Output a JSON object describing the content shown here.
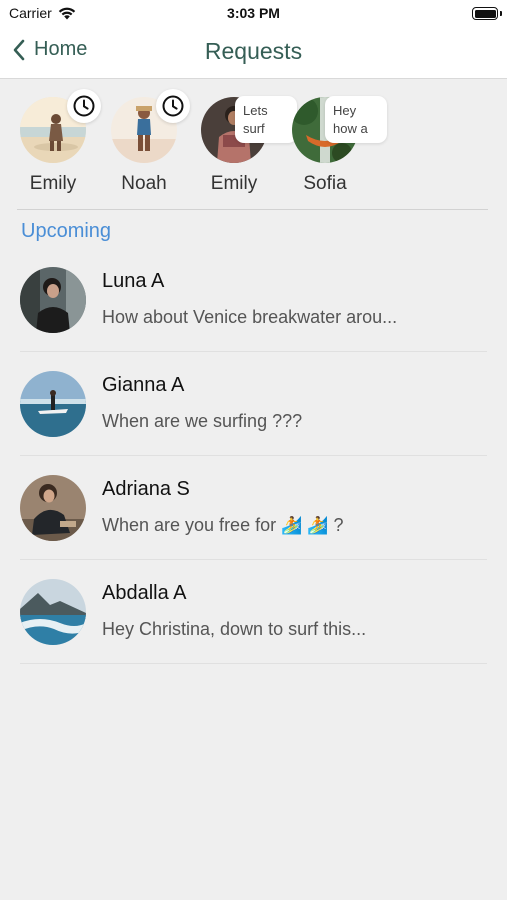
{
  "status_bar": {
    "carrier": "Carrier",
    "time": "3:03 PM"
  },
  "nav": {
    "back_label": "Home",
    "title": "Requests"
  },
  "stories": [
    {
      "name": "Emily",
      "badge": "clock"
    },
    {
      "name": "Noah",
      "badge": "clock"
    },
    {
      "name": "Emily",
      "bubble": "Lets surf"
    },
    {
      "name": "Sofia",
      "bubble": "Hey how a"
    }
  ],
  "section_header": "Upcoming",
  "conversations": [
    {
      "name": "Luna A",
      "preview": "How about Venice breakwater arou..."
    },
    {
      "name": "Gianna A",
      "preview": "When are we surfing ???"
    },
    {
      "name": "Adriana S",
      "preview_prefix": "When are you free for",
      "preview_emoji": "🏄",
      "preview_suffix": "?"
    },
    {
      "name": "Abdalla A",
      "preview": "Hey Christina, down to surf this..."
    }
  ],
  "colors": {
    "accent_green": "#355e55",
    "section_blue": "#4a8ed6",
    "background": "#efefef"
  }
}
